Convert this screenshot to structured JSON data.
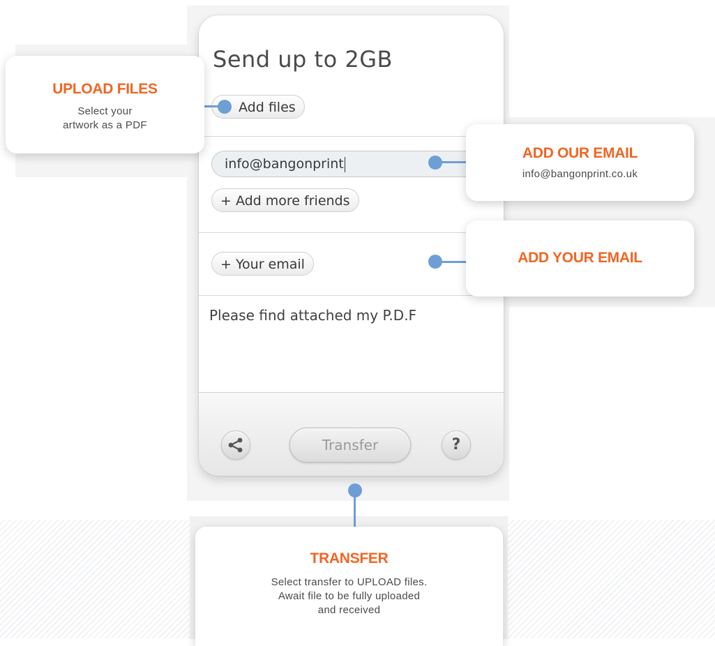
{
  "widget": {
    "title": "Send up to 2GB",
    "add_files_label": "Add files",
    "email_value": "info@bangonprint",
    "add_more_friends_label": "+ Add more friends",
    "your_email_label": "+ Your email",
    "message_text": "Please find attached my P.D.F",
    "transfer_label": "Transfer",
    "help_label": "?"
  },
  "callouts": {
    "upload": {
      "title": "UPLOAD FILES",
      "body_line1": "Select your",
      "body_line2": "artwork as a PDF"
    },
    "our_email": {
      "title": "ADD OUR EMAIL",
      "body": "info@bangonprint.co.uk"
    },
    "your_email": {
      "title": "ADD YOUR EMAIL"
    },
    "transfer": {
      "title": "TRANSFER",
      "body_line1": "Select transfer to UPLOAD files.",
      "body_line2": "Await file to be fully uploaded",
      "body_line3": "and received"
    }
  },
  "colors": {
    "accent_orange": "#f26522",
    "connector_blue": "#6d9fd6"
  },
  "icons": [
    "share-icon",
    "help-icon"
  ]
}
